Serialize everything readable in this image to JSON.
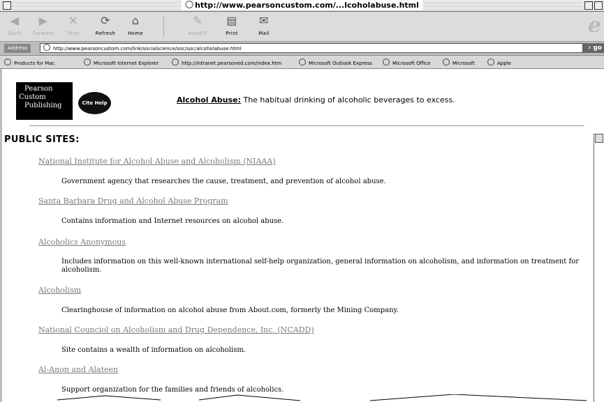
{
  "window": {
    "title": "http://www.pearsoncustom.com/...lcoholabuse.html"
  },
  "toolbar": {
    "buttons": [
      {
        "label": "Back",
        "icon": "back-arrow-icon",
        "enabled": false
      },
      {
        "label": "Forward",
        "icon": "forward-arrow-icon",
        "enabled": false
      },
      {
        "label": "Stop",
        "icon": "stop-x-icon",
        "enabled": false
      },
      {
        "label": "Refresh",
        "icon": "refresh-icon",
        "enabled": true
      },
      {
        "label": "Home",
        "icon": "home-icon",
        "enabled": true
      },
      {
        "label": "AutoFill",
        "icon": "autofill-pencil-icon",
        "enabled": false
      },
      {
        "label": "Print",
        "icon": "printer-icon",
        "enabled": true
      },
      {
        "label": "Mail",
        "icon": "mail-icon",
        "enabled": true
      }
    ]
  },
  "address": {
    "label": "Address",
    "url": "http://www.pearsoncustom.com/link/socialscience/soc/soc/alcoholabuse.html",
    "go_label": "go"
  },
  "favorites": [
    "Products for Mac",
    "Microsoft Internet Explorer",
    "http://intranet.pearsoned.com/index.htm",
    "Microsoft Outlook Express",
    "Microsoft Office",
    "Microsoft",
    "Apple"
  ],
  "page": {
    "logo": {
      "line1": "Pearson",
      "line2": "Custom",
      "line3": "Publishing"
    },
    "cite_help": "Cite Help",
    "term": "Alcohol Abuse:",
    "definition": " The habitual drinking of alcoholic beverages to excess.",
    "section_title": "PUBLIC SITES:",
    "sites": [
      {
        "name": "National Institute for Alcohol Abuse and Alcoholism (NIAAA)",
        "description": "Government agency that researches the cause, treatment, and prevention of alcohol abuse."
      },
      {
        "name": "Santa Barbara Drug and Alcohol Abuse Program",
        "description": "Contains information and Internet resources on alcohol abuse."
      },
      {
        "name": "Alcoholics Anonymous",
        "description": "Includes information on this well-known international self-help organization, general information on alcoholism, and information on treatment for alcoholism."
      },
      {
        "name": "Alcoholism",
        "description": "Clearinghouse of information on alcohol abuse from About.com, formerly the Mining Company."
      },
      {
        "name": "National Counciol on Alcoholism and Drug Dependence, Inc. (NCADD)",
        "description": "Site contains a wealth of information on alcoholism."
      },
      {
        "name": "Al-Anon and Alateen",
        "description": "Support organization for the families and friends of alcoholics."
      }
    ]
  }
}
